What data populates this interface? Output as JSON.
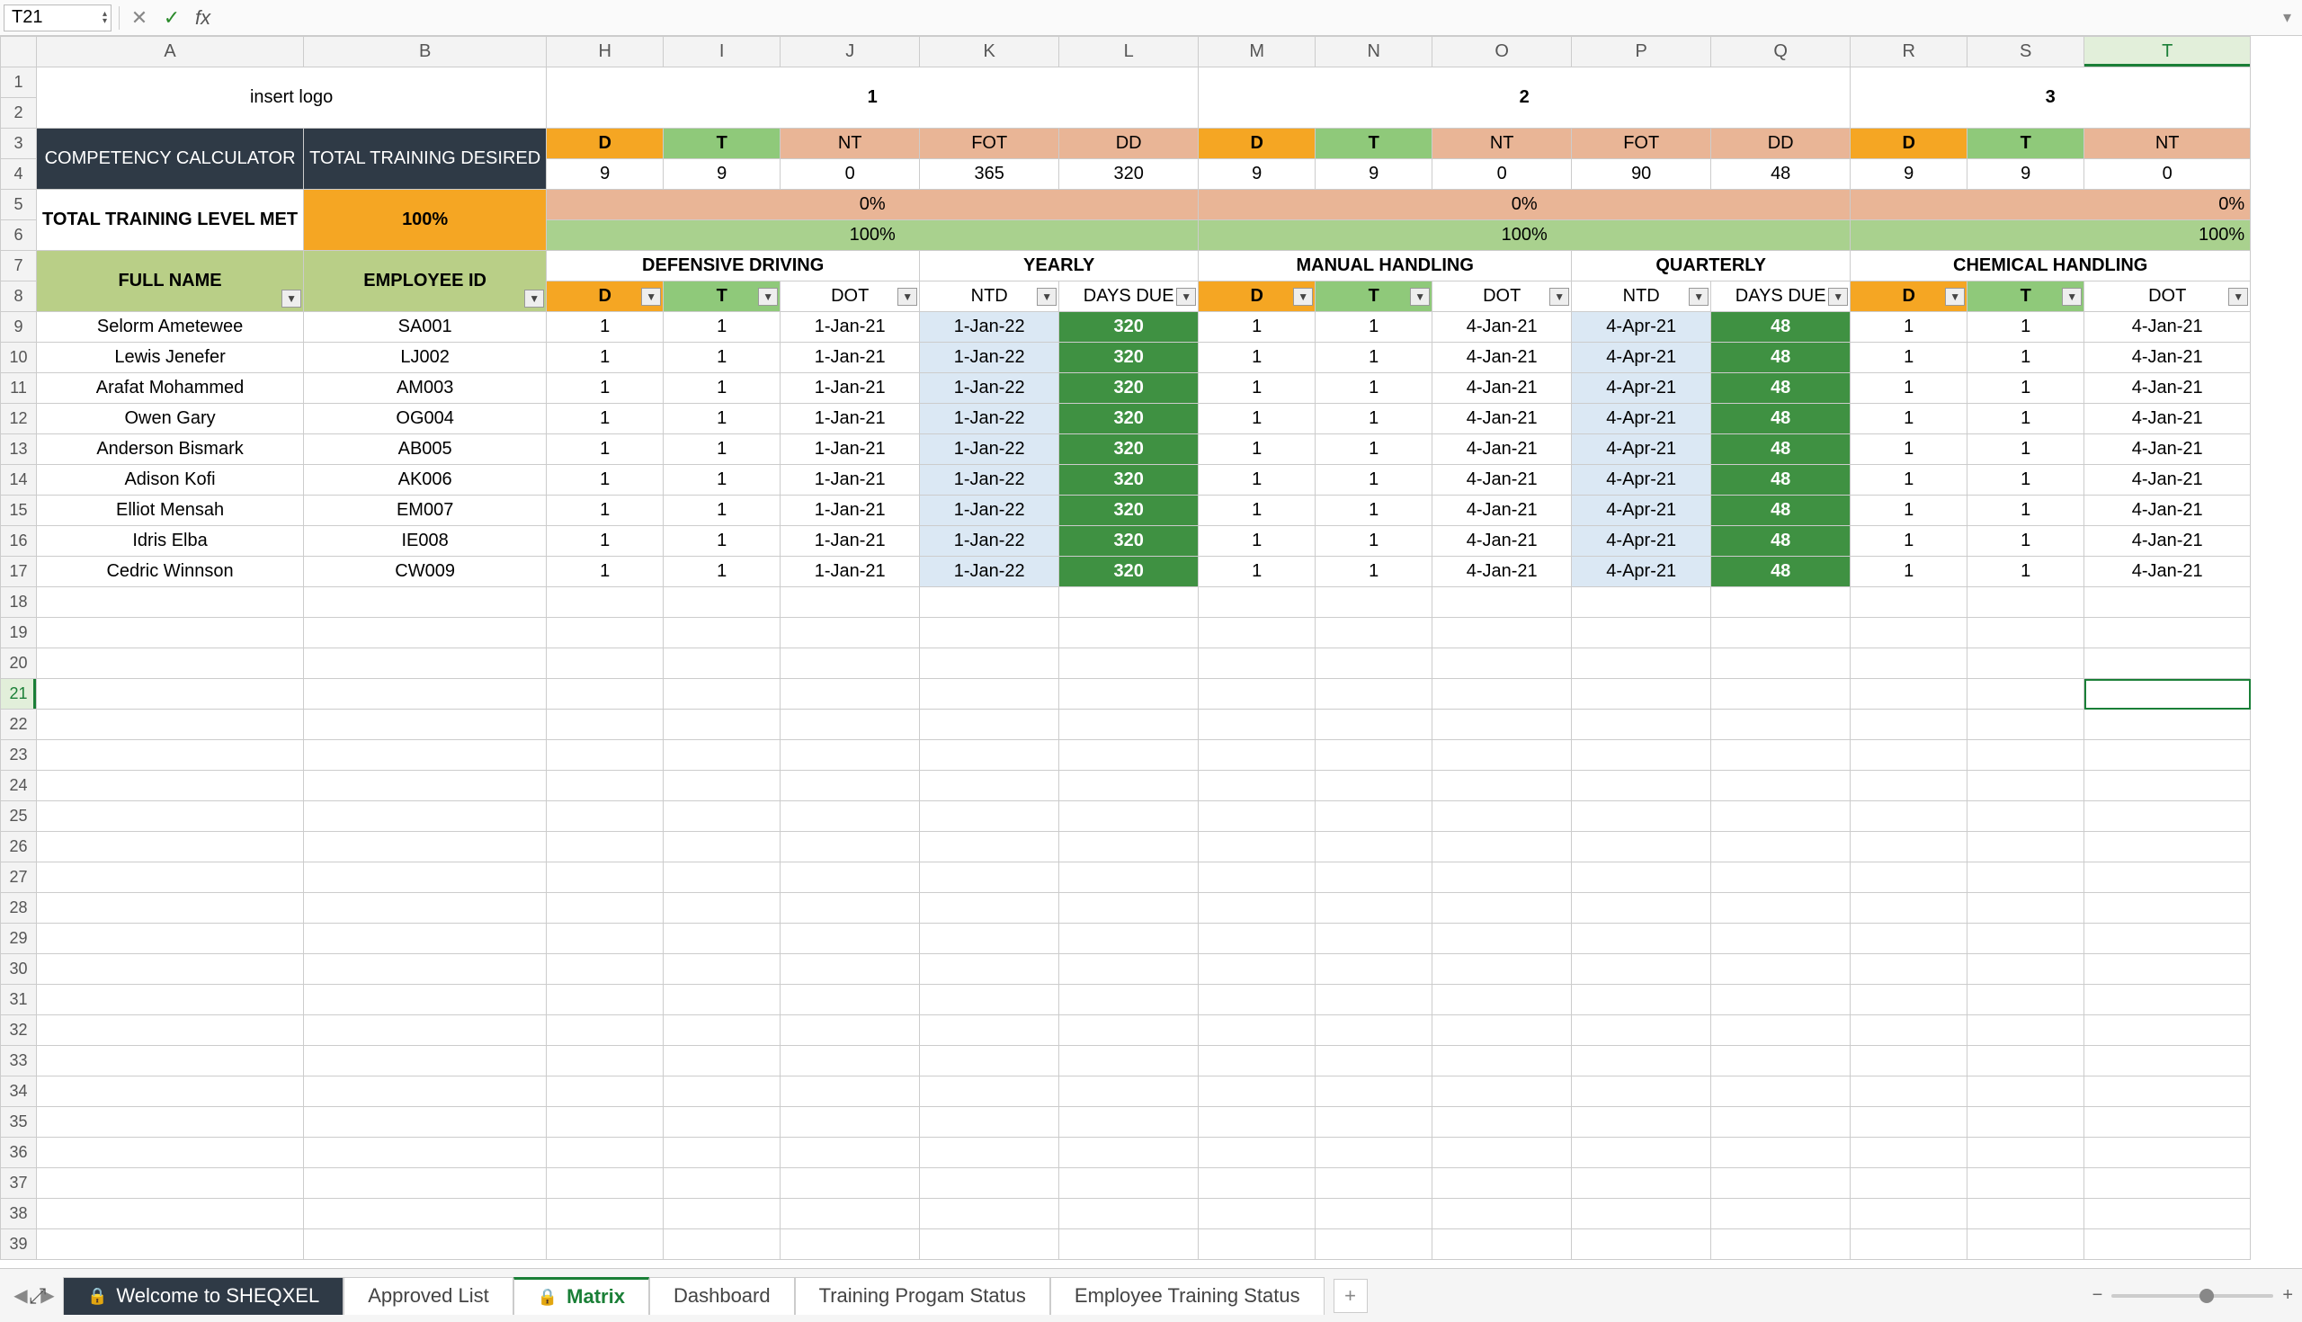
{
  "namebox": "T21",
  "fx": "",
  "cols": [
    "A",
    "B",
    "H",
    "I",
    "J",
    "K",
    "L",
    "M",
    "N",
    "O",
    "P",
    "Q",
    "R",
    "S",
    "T"
  ],
  "active_col": "T",
  "active_row": 21,
  "logo_text": "insert logo",
  "hdr": {
    "comp": "COMPETENCY  CALCULATOR",
    "desired": "TOTAL TRAINING DESIRED",
    "met": "TOTAL TRAINING LEVEL MET",
    "met_val": "100%",
    "full": "FULL NAME",
    "emp": "EMPLOYEE ID"
  },
  "bands": [
    {
      "n": "1",
      "d": "9",
      "t": "9",
      "nt": "0",
      "fot": "365",
      "dd": "320",
      "pct0": "0%",
      "pct100": "100%",
      "title": "DEFENSIVE DRIVING",
      "period": "YEARLY"
    },
    {
      "n": "2",
      "d": "9",
      "t": "9",
      "nt": "0",
      "fot": "90",
      "dd": "48",
      "pct0": "0%",
      "pct100": "100%",
      "title": "MANUAL HANDLING",
      "period": "QUARTERLY"
    },
    {
      "n": "3",
      "d": "9",
      "t": "9",
      "nt": "0",
      "fot": "",
      "dd": "",
      "pct0": "0%",
      "pct100": "100%",
      "title": "CHEMICAL HANDLING",
      "period": ""
    }
  ],
  "band_hdr": {
    "D": "D",
    "T": "T",
    "NT": "NT",
    "FOT": "FOT",
    "DD": "DD"
  },
  "subcols": {
    "D": "D",
    "T": "T",
    "DOT": "DOT",
    "NTD": "NTD",
    "DAYSDUE": "DAYS DUE"
  },
  "rows": [
    {
      "r": 9,
      "name": "Selorm Ametewee",
      "id": "SA001"
    },
    {
      "r": 10,
      "name": "Lewis Jenefer",
      "id": "LJ002"
    },
    {
      "r": 11,
      "name": "Arafat Mohammed",
      "id": "AM003"
    },
    {
      "r": 12,
      "name": "Owen Gary",
      "id": "OG004"
    },
    {
      "r": 13,
      "name": "Anderson Bismark",
      "id": "AB005"
    },
    {
      "r": 14,
      "name": "Adison Kofi",
      "id": "AK006"
    },
    {
      "r": 15,
      "name": "Elliot Mensah",
      "id": "EM007"
    },
    {
      "r": 16,
      "name": "Idris Elba",
      "id": "IE008"
    },
    {
      "r": 17,
      "name": "Cedric Winnson",
      "id": "CW009"
    }
  ],
  "cellvals": {
    "one": "1",
    "dot1": "1-Jan-21",
    "ntd1": "1-Jan-22",
    "dd1": "320",
    "dot2": "4-Jan-21",
    "ntd2": "4-Apr-21",
    "dd2": "48",
    "dot3": "4-Jan-21"
  },
  "empty_rows": [
    18,
    19,
    20,
    21,
    22,
    23,
    24,
    25,
    26,
    27,
    28,
    29,
    30,
    31,
    32,
    33,
    34,
    35,
    36,
    37,
    38,
    39
  ],
  "tabs": [
    {
      "label": "Welcome to SHEQXEL",
      "dark": true,
      "lock": true
    },
    {
      "label": "Approved List"
    },
    {
      "label": "Matrix",
      "lock": true,
      "active": true,
      "green": true
    },
    {
      "label": "Dashboard"
    },
    {
      "label": "Training Progam Status"
    },
    {
      "label": "Employee Training Status"
    }
  ]
}
